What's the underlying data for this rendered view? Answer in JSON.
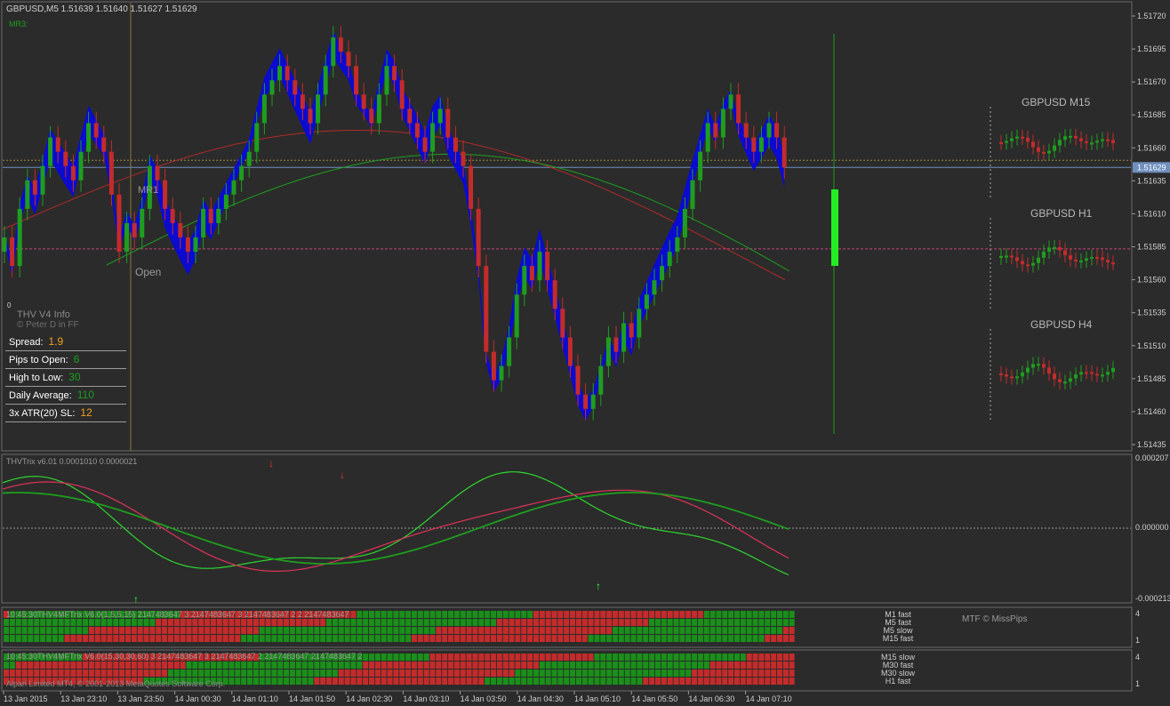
{
  "window": {
    "title": "GBPUSD,M5  1.51639 1.51640 1.51627 1.51629",
    "top_label": "MR3:",
    "colors": {
      "background": "#2b2b2b",
      "bull": "#1e9e1e",
      "bear": "#c42b2b",
      "cloud": "#0a0ad8",
      "bid_line": "#6f8fbf",
      "current_bar": "#22ee22"
    }
  },
  "price_axis": {
    "labels": [
      "1.51720",
      "1.51695",
      "1.51670",
      "1.51685",
      "1.51660",
      "1.51635",
      "1.51610",
      "1.51585",
      "1.51560",
      "1.51535",
      "1.51510",
      "1.51485",
      "1.51460",
      "1.51435"
    ],
    "current": "1.51629"
  },
  "chart_labels": {
    "mr1": "MR1",
    "open": "Open",
    "zero": "0"
  },
  "info_panel": {
    "title": "THV  V4  Info",
    "credit": "© Peter D in FF",
    "rows": [
      {
        "label": "Spread:",
        "value": "1.9",
        "color": "#f0a020"
      },
      {
        "label": "Pips to Open:",
        "value": "6",
        "color": "#1e9e1e"
      },
      {
        "label": "High to Low:",
        "value": "30",
        "color": "#1e9e1e"
      },
      {
        "label": "Daily Average:",
        "value": "110",
        "color": "#1e9e1e"
      },
      {
        "label": "3x ATR(20) SL:",
        "value": "12",
        "color": "#f0a020"
      }
    ]
  },
  "mtf_titles": [
    "GBPUSD  M15",
    "GBPUSD  H1",
    "GBPUSD  H4"
  ],
  "trix": {
    "title": "THVTrix v6.01 0.0001010 0.0000021",
    "axis": [
      "0.000207",
      "0.000000",
      "-0.000213"
    ]
  },
  "heatmap1": {
    "header": "10:45:30THV4MFTrix V6.0(1,5,5,15) 2147483647 3 2147483647 3 2147483647 2 2 2147483647",
    "rows": [
      "M1 fast",
      "M5 fast",
      "M5 slow",
      "M15 fast"
    ],
    "credit": "MTF © MissPips",
    "axis": [
      "4",
      "1"
    ]
  },
  "heatmap2": {
    "header": "10:45:30THV4MFTrix V6.0(15,30,30,60) 3 2147483647 3 2147483647 2 2147483647 2147483647 2",
    "rows": [
      "M15 slow",
      "M30 fast",
      "M30 slow",
      "H1 fast"
    ],
    "footer": "Alpari Limited MT4, © 2001-2013 MetaQuotes Software Corp.",
    "axis": [
      "4",
      "1"
    ]
  },
  "time_axis": [
    "13 Jan 2015",
    "13 Jan 23:10",
    "13 Jan 23:50",
    "14 Jan 00:30",
    "14 Jan 01:10",
    "14 Jan 01:50",
    "14 Jan 02:30",
    "14 Jan 03:10",
    "14 Jan 03:50",
    "14 Jan 04:30",
    "14 Jan 05:10",
    "14 Jan 05:50",
    "14 Jan 06:30",
    "14 Jan 07:10"
  ],
  "chart_data": {
    "type": "candlestick",
    "symbol": "GBPUSD",
    "timeframe": "M5",
    "ylim": [
      1.51435,
      1.51735
    ],
    "bid": 1.51629,
    "open_level": 1.51572,
    "closes": [
      1.5158,
      1.5156,
      1.516,
      1.5162,
      1.5161,
      1.5163,
      1.5165,
      1.5164,
      1.5163,
      1.5162,
      1.5164,
      1.5166,
      1.5165,
      1.5164,
      1.5161,
      1.5157,
      1.5159,
      1.5158,
      1.516,
      1.5163,
      1.5162,
      1.516,
      1.5159,
      1.5158,
      1.5157,
      1.5158,
      1.516,
      1.5159,
      1.516,
      1.5161,
      1.5162,
      1.5163,
      1.5164,
      1.5166,
      1.5168,
      1.5169,
      1.517,
      1.5169,
      1.5168,
      1.5167,
      1.5166,
      1.5168,
      1.517,
      1.5172,
      1.5171,
      1.517,
      1.5168,
      1.5167,
      1.5166,
      1.5168,
      1.517,
      1.5169,
      1.5167,
      1.5166,
      1.5165,
      1.5164,
      1.5166,
      1.5167,
      1.5165,
      1.5164,
      1.5163,
      1.516,
      1.5156,
      1.515,
      1.5148,
      1.5149,
      1.5151,
      1.5154,
      1.5156,
      1.5155,
      1.5157,
      1.5155,
      1.5153,
      1.5151,
      1.5149,
      1.5147,
      1.5146,
      1.5147,
      1.5149,
      1.5151,
      1.515,
      1.5152,
      1.5151,
      1.5153,
      1.5154,
      1.5155,
      1.5156,
      1.5157,
      1.5158,
      1.516,
      1.5162,
      1.5164,
      1.5166,
      1.5165,
      1.5167,
      1.5168,
      1.5166,
      1.5165,
      1.5164,
      1.5165,
      1.5166,
      1.5165,
      1.51629
    ]
  }
}
